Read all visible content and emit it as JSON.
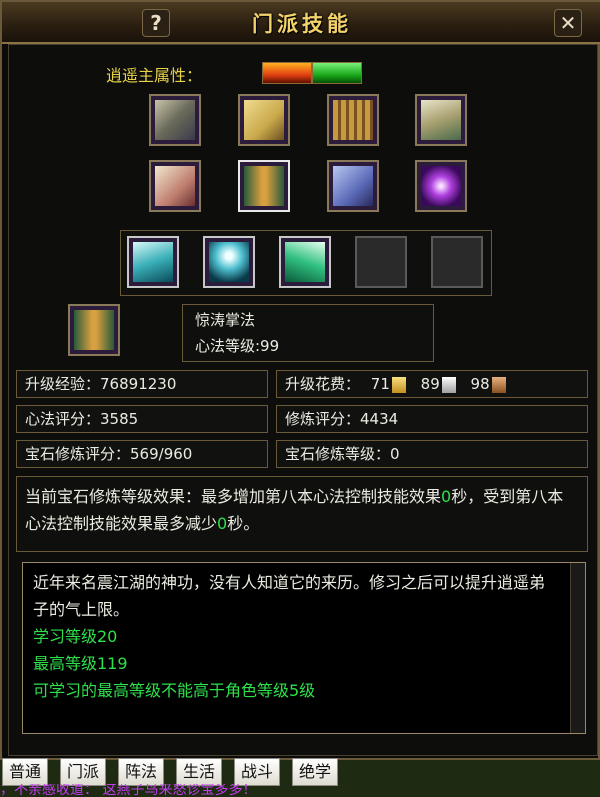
{
  "window": {
    "title": "门派技能",
    "help_label": "?",
    "close_label": "✕"
  },
  "attribute": {
    "label": "逍遥主属性："
  },
  "skill_books": [
    {
      "name": "book-1"
    },
    {
      "name": "book-2"
    },
    {
      "name": "book-3"
    },
    {
      "name": "book-4"
    },
    {
      "name": "book-5"
    },
    {
      "name": "book-6"
    },
    {
      "name": "book-7"
    },
    {
      "name": "book-8"
    }
  ],
  "selected_skill": {
    "name": "惊涛掌法",
    "level_text": "心法等级:99"
  },
  "stats": {
    "exp_label": "升级经验：",
    "exp_value": "76891230",
    "cost_label": "升级花费：",
    "cost_gold": "71",
    "cost_silver": "89",
    "cost_bronze": "98",
    "xinfa_label": "心法评分：",
    "xinfa_value": "3585",
    "xiulian_label": "修炼评分：",
    "xiulian_value": "4434",
    "gem_score_label": "宝石修炼评分：",
    "gem_score_value": "569/960",
    "gem_level_label": "宝石修炼等级：",
    "gem_level_value": "0"
  },
  "effect": {
    "prefix": "当前宝石修炼等级效果：最多增加第八本心法控制技能效果",
    "val1": "0",
    "mid": "秒，受到第八本心法控制技能效果最多减少",
    "val2": "0",
    "suffix": "秒。"
  },
  "description": {
    "text": "近年来名震江湖的神功，没有人知道它的来历。修习之后可以提升逍遥弟子的气上限。",
    "learn_level": "学习等级20",
    "max_level": "最高等级119",
    "limit": "可学习的最高等级不能高于角色等级5级"
  },
  "tabs": [
    "普通",
    "门派",
    "阵法",
    "生活",
    "战斗",
    "绝学"
  ],
  "chat_text": "，不亲感收道：   这燕子鸟来怒诊宝多多！",
  "colors": {
    "gold": "#f3d36a",
    "green": "#2ee04a",
    "border": "#6b5a3a"
  }
}
